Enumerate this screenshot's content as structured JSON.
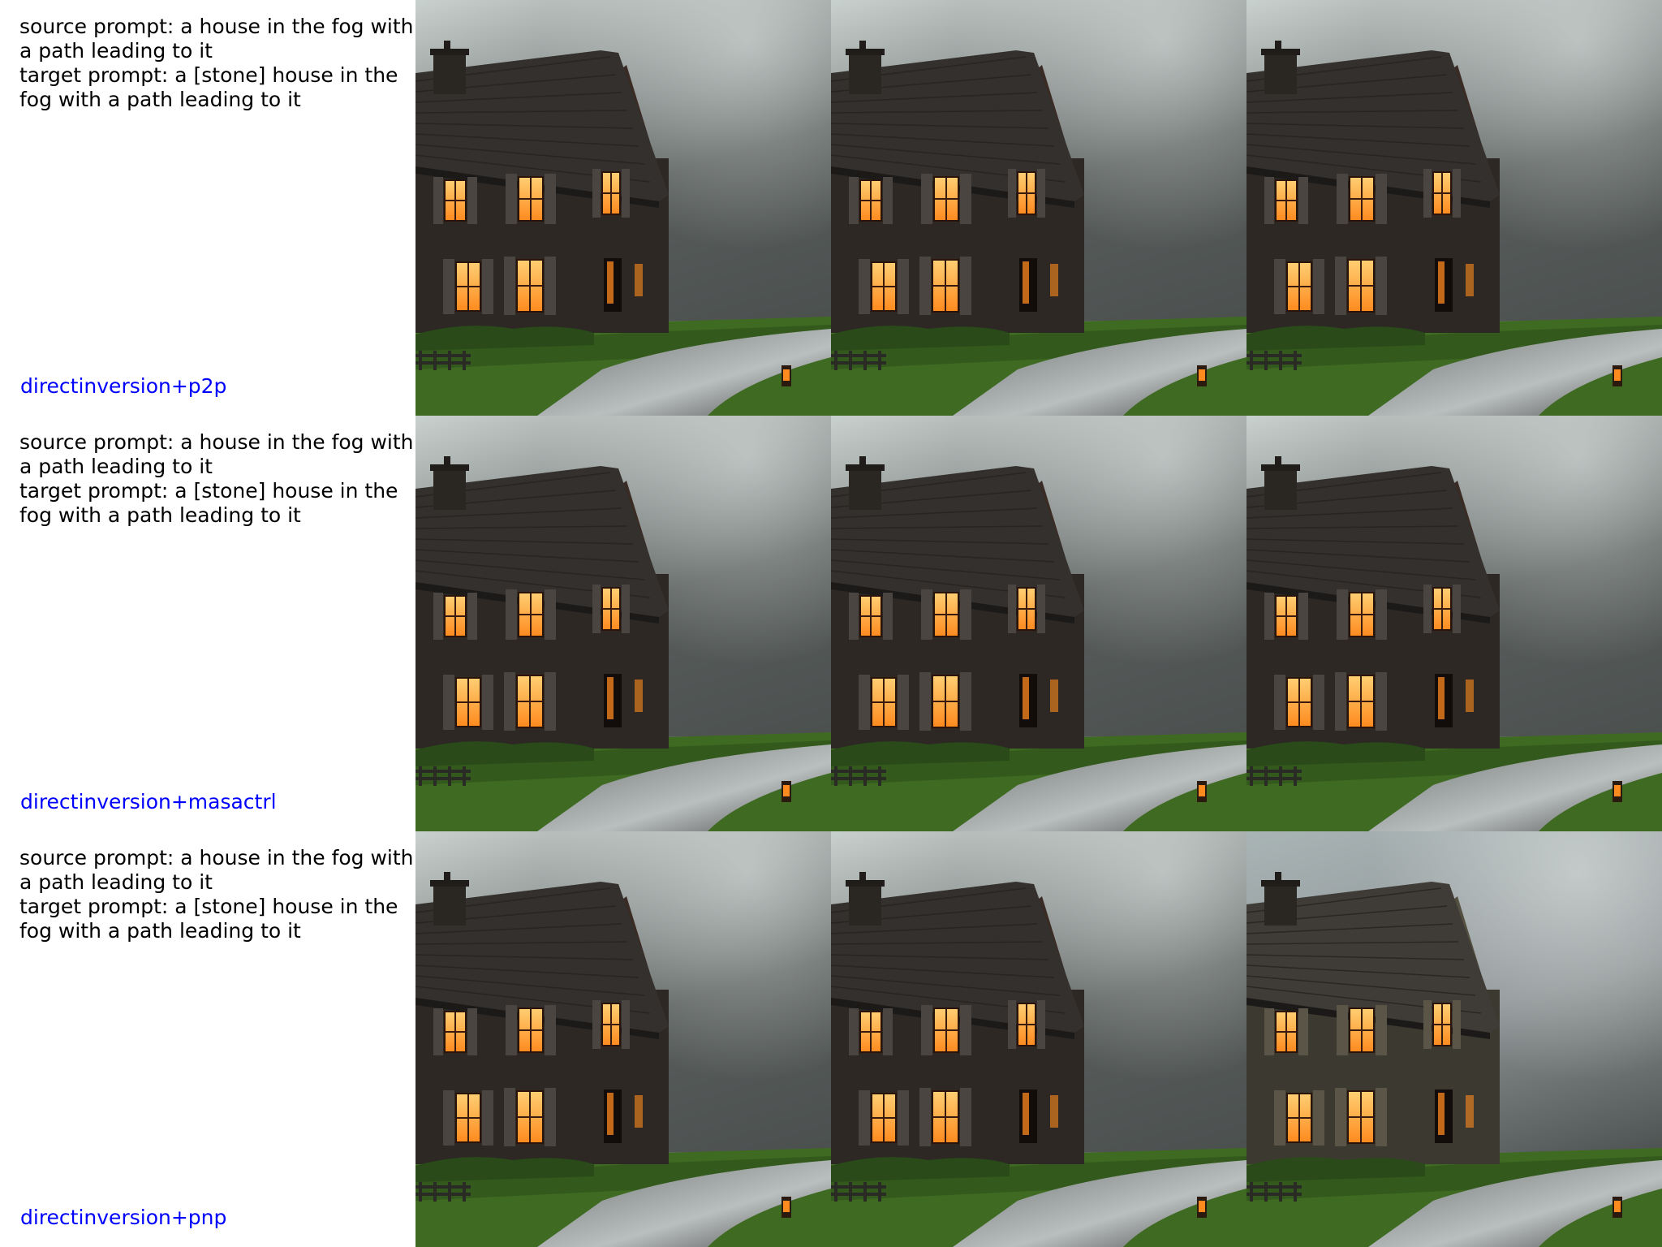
{
  "rows": [
    {
      "source_prompt": "source prompt: a house in the fog with a path leading to it",
      "target_prompt": "target prompt: a [stone] house in the fog with a path leading to it",
      "method": "directinversion+p2p"
    },
    {
      "source_prompt": "source prompt: a house in the fog with a path leading to it",
      "target_prompt": "target prompt: a [stone] house in the fog with a path leading to it",
      "method": "directinversion+masactrl"
    },
    {
      "source_prompt": "source prompt: a house in the fog with a path leading to it",
      "target_prompt": "target prompt: a [stone] house in the fog with a path leading to it",
      "method": "directinversion+pnp"
    }
  ],
  "colors": {
    "method_label": "#0000ff",
    "prompt_text": "#000000",
    "window_glow": "#ff8a1e",
    "grass": "#3f6a22",
    "fog": "#8f9594"
  }
}
